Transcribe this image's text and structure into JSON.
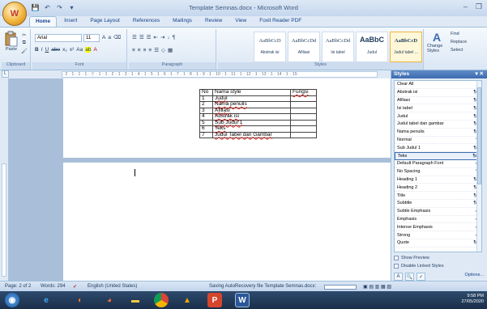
{
  "window": {
    "title": "Template Semnas.docx - Microsoft Word",
    "office_button": "W",
    "minimize": "–",
    "restore": "❐"
  },
  "qat": [
    "💾",
    "↶",
    "↷",
    "▾"
  ],
  "tabs": [
    "Home",
    "Insert",
    "Page Layout",
    "References",
    "Mailings",
    "Review",
    "View",
    "Foxit Reader PDF"
  ],
  "ribbon": {
    "clipboard": {
      "label": "Clipboard",
      "paste": "Paste"
    },
    "font": {
      "label": "Font",
      "name": "Arial",
      "size": "11",
      "row2": [
        "B",
        "I",
        "U",
        "abe",
        "x₂",
        "x²",
        "Aa",
        "ab",
        "A"
      ]
    },
    "paragraph": {
      "label": "Paragraph",
      "row1": [
        "☰",
        "☰",
        "☰",
        "⇤",
        "⇥",
        "↓",
        "¶"
      ],
      "row2": [
        "≡",
        "≡",
        "≡",
        "≡",
        "☰",
        "◇",
        "▦"
      ]
    },
    "styles": {
      "label": "Styles",
      "tiles": [
        {
          "sample": "AaBbCcD",
          "name": "Abstrak isi"
        },
        {
          "sample": "AaBbCcDd",
          "name": "Afiliasi"
        },
        {
          "sample": "AaBbCcDd",
          "name": "Isi tabel"
        },
        {
          "sample": "AaBbC",
          "name": "Judul"
        },
        {
          "sample": "AaBbCcD",
          "name": "Judul tabel ..."
        }
      ],
      "change_styles": "Change Styles"
    },
    "editing": {
      "find": "Find",
      "replace": "Replace",
      "select": "Select"
    }
  },
  "ruler_text": "· 2 · 1 · 1 · 1 · ▽ · 1 · 1 · 2 · 1 · 3 · 1 · 4 · 1 · 5 · 1 · 6 · 1 · 7 · 1 · 8 · 1 · 9 · 1 · 10 · 1 · 11 · 1 · 12 · 1 · 13 · 1 · 14 · 1 · 15",
  "document": {
    "table_header": {
      "no": "No",
      "name": "Nama style",
      "func": "Fungsi"
    },
    "rows": [
      {
        "no": "1",
        "name": "Judul"
      },
      {
        "no": "2",
        "name": "Nama penulis"
      },
      {
        "no": "3",
        "name": "Afiliasi"
      },
      {
        "no": "4",
        "name": "Abstrak isi"
      },
      {
        "no": "5",
        "name": "Sub Judul 1"
      },
      {
        "no": "6",
        "name": "Teks"
      },
      {
        "no": "7",
        "name": "Judul Tabel dan Gambar"
      }
    ]
  },
  "styles_pane": {
    "title": "Styles",
    "close": "▾ ✕",
    "items": [
      {
        "name": "Clear All",
        "key": ""
      },
      {
        "name": "Abstrak isi",
        "key": "¶a"
      },
      {
        "name": "Afiliasi",
        "key": "¶a"
      },
      {
        "name": "Isi tabel",
        "key": "¶a"
      },
      {
        "name": "Judul",
        "key": "¶a"
      },
      {
        "name": "Judul tabel dan gambar",
        "key": "¶a"
      },
      {
        "name": "Nama penulis",
        "key": "¶a"
      },
      {
        "name": "Normal",
        "key": "¶"
      },
      {
        "name": "Sub Judul 1",
        "key": "¶a"
      },
      {
        "name": "Teks",
        "key": "¶a"
      },
      {
        "name": "Default Paragraph Font",
        "key": "a"
      },
      {
        "name": "No Spacing",
        "key": "¶"
      },
      {
        "name": "Heading 1",
        "key": "¶a"
      },
      {
        "name": "Heading 2",
        "key": "¶a"
      },
      {
        "name": "Title",
        "key": "¶a"
      },
      {
        "name": "Subtitle",
        "key": "¶a"
      },
      {
        "name": "Subtle Emphasis",
        "key": "a"
      },
      {
        "name": "Emphasis",
        "key": "a"
      },
      {
        "name": "Intense Emphasis",
        "key": "a"
      },
      {
        "name": "Strong",
        "key": "a"
      },
      {
        "name": "Quote",
        "key": "¶a"
      }
    ],
    "selected_index": 9,
    "show_preview": "Show Preview",
    "disable_linked": "Disable Linked Styles",
    "options": "Options..."
  },
  "status": {
    "page": "Page: 2 of 2",
    "words": "Words: 294",
    "language": "English (United States)",
    "autosave": "Saving AutoRecovery file Template Semnas.docx:"
  },
  "taskbar": {
    "time": "9:58 PM",
    "date": "27/05/2020"
  }
}
